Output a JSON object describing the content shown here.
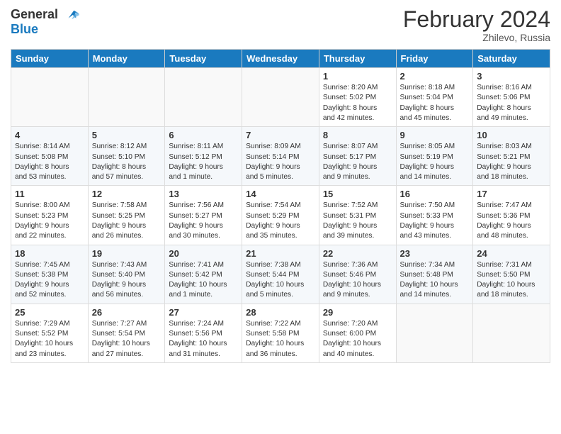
{
  "header": {
    "logo_line1": "General",
    "logo_line2": "Blue",
    "month": "February 2024",
    "location": "Zhilevo, Russia"
  },
  "weekdays": [
    "Sunday",
    "Monday",
    "Tuesday",
    "Wednesday",
    "Thursday",
    "Friday",
    "Saturday"
  ],
  "weeks": [
    [
      {
        "day": "",
        "info": ""
      },
      {
        "day": "",
        "info": ""
      },
      {
        "day": "",
        "info": ""
      },
      {
        "day": "",
        "info": ""
      },
      {
        "day": "1",
        "info": "Sunrise: 8:20 AM\nSunset: 5:02 PM\nDaylight: 8 hours\nand 42 minutes."
      },
      {
        "day": "2",
        "info": "Sunrise: 8:18 AM\nSunset: 5:04 PM\nDaylight: 8 hours\nand 45 minutes."
      },
      {
        "day": "3",
        "info": "Sunrise: 8:16 AM\nSunset: 5:06 PM\nDaylight: 8 hours\nand 49 minutes."
      }
    ],
    [
      {
        "day": "4",
        "info": "Sunrise: 8:14 AM\nSunset: 5:08 PM\nDaylight: 8 hours\nand 53 minutes."
      },
      {
        "day": "5",
        "info": "Sunrise: 8:12 AM\nSunset: 5:10 PM\nDaylight: 8 hours\nand 57 minutes."
      },
      {
        "day": "6",
        "info": "Sunrise: 8:11 AM\nSunset: 5:12 PM\nDaylight: 9 hours\nand 1 minute."
      },
      {
        "day": "7",
        "info": "Sunrise: 8:09 AM\nSunset: 5:14 PM\nDaylight: 9 hours\nand 5 minutes."
      },
      {
        "day": "8",
        "info": "Sunrise: 8:07 AM\nSunset: 5:17 PM\nDaylight: 9 hours\nand 9 minutes."
      },
      {
        "day": "9",
        "info": "Sunrise: 8:05 AM\nSunset: 5:19 PM\nDaylight: 9 hours\nand 14 minutes."
      },
      {
        "day": "10",
        "info": "Sunrise: 8:03 AM\nSunset: 5:21 PM\nDaylight: 9 hours\nand 18 minutes."
      }
    ],
    [
      {
        "day": "11",
        "info": "Sunrise: 8:00 AM\nSunset: 5:23 PM\nDaylight: 9 hours\nand 22 minutes."
      },
      {
        "day": "12",
        "info": "Sunrise: 7:58 AM\nSunset: 5:25 PM\nDaylight: 9 hours\nand 26 minutes."
      },
      {
        "day": "13",
        "info": "Sunrise: 7:56 AM\nSunset: 5:27 PM\nDaylight: 9 hours\nand 30 minutes."
      },
      {
        "day": "14",
        "info": "Sunrise: 7:54 AM\nSunset: 5:29 PM\nDaylight: 9 hours\nand 35 minutes."
      },
      {
        "day": "15",
        "info": "Sunrise: 7:52 AM\nSunset: 5:31 PM\nDaylight: 9 hours\nand 39 minutes."
      },
      {
        "day": "16",
        "info": "Sunrise: 7:50 AM\nSunset: 5:33 PM\nDaylight: 9 hours\nand 43 minutes."
      },
      {
        "day": "17",
        "info": "Sunrise: 7:47 AM\nSunset: 5:36 PM\nDaylight: 9 hours\nand 48 minutes."
      }
    ],
    [
      {
        "day": "18",
        "info": "Sunrise: 7:45 AM\nSunset: 5:38 PM\nDaylight: 9 hours\nand 52 minutes."
      },
      {
        "day": "19",
        "info": "Sunrise: 7:43 AM\nSunset: 5:40 PM\nDaylight: 9 hours\nand 56 minutes."
      },
      {
        "day": "20",
        "info": "Sunrise: 7:41 AM\nSunset: 5:42 PM\nDaylight: 10 hours\nand 1 minute."
      },
      {
        "day": "21",
        "info": "Sunrise: 7:38 AM\nSunset: 5:44 PM\nDaylight: 10 hours\nand 5 minutes."
      },
      {
        "day": "22",
        "info": "Sunrise: 7:36 AM\nSunset: 5:46 PM\nDaylight: 10 hours\nand 9 minutes."
      },
      {
        "day": "23",
        "info": "Sunrise: 7:34 AM\nSunset: 5:48 PM\nDaylight: 10 hours\nand 14 minutes."
      },
      {
        "day": "24",
        "info": "Sunrise: 7:31 AM\nSunset: 5:50 PM\nDaylight: 10 hours\nand 18 minutes."
      }
    ],
    [
      {
        "day": "25",
        "info": "Sunrise: 7:29 AM\nSunset: 5:52 PM\nDaylight: 10 hours\nand 23 minutes."
      },
      {
        "day": "26",
        "info": "Sunrise: 7:27 AM\nSunset: 5:54 PM\nDaylight: 10 hours\nand 27 minutes."
      },
      {
        "day": "27",
        "info": "Sunrise: 7:24 AM\nSunset: 5:56 PM\nDaylight: 10 hours\nand 31 minutes."
      },
      {
        "day": "28",
        "info": "Sunrise: 7:22 AM\nSunset: 5:58 PM\nDaylight: 10 hours\nand 36 minutes."
      },
      {
        "day": "29",
        "info": "Sunrise: 7:20 AM\nSunset: 6:00 PM\nDaylight: 10 hours\nand 40 minutes."
      },
      {
        "day": "",
        "info": ""
      },
      {
        "day": "",
        "info": ""
      }
    ]
  ]
}
